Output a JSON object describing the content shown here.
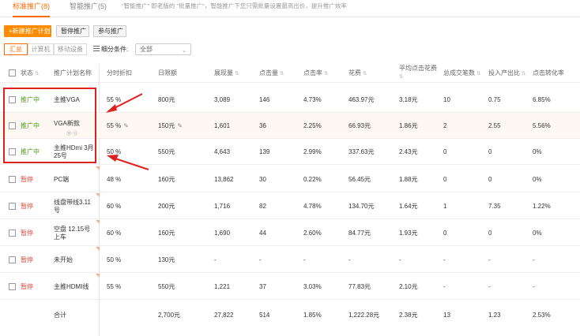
{
  "tabs": {
    "standard": "标准推广(8)",
    "smart": "智能推广(5)",
    "note": "\"智能推广\" 即老版的 \"批量推广\"，智能推广下您只需批量设置最高出价，提升推广效率"
  },
  "toolbar": {
    "new_plan": "+新建推广计划",
    "pause": "暂停推广",
    "join": "参与推广"
  },
  "device_tabs": [
    "汇总",
    "计算机",
    "移动设备"
  ],
  "filter": {
    "label": "细分条件:",
    "value": "全部"
  },
  "columns": {
    "status": "状态",
    "name": "推广计划名称",
    "discount": "分时折扣",
    "budget": "日限额",
    "impressions": "展现量",
    "clicks": "点击量",
    "ctr": "点击率",
    "cost": "花费",
    "cpc_line1": "平均点击花费",
    "deals": "总成交笔数",
    "roi": "投入产出比",
    "cvr": "点击转化率"
  },
  "rows": [
    {
      "status": "推广中",
      "on": true,
      "name": "主推VGA",
      "discount": "55 %",
      "budget": "800元",
      "impressions": "3,089",
      "clicks": "146",
      "ctr": "4.73%",
      "cost": "463.97元",
      "cpc": "3.18元",
      "deals": "10",
      "roi": "0.75",
      "cvr": "6.85%"
    },
    {
      "status": "推广中",
      "on": true,
      "name": "VGA新款",
      "discount": "55 %",
      "budget": "150元",
      "impressions": "1,601",
      "clicks": "36",
      "ctr": "2.25%",
      "cost": "66.93元",
      "cpc": "1.86元",
      "deals": "2",
      "roi": "2.55",
      "cvr": "5.56%"
    },
    {
      "status": "推广中",
      "on": true,
      "name": "主推HDmi 3月25号",
      "discount": "50 %",
      "budget": "550元",
      "impressions": "4,643",
      "clicks": "139",
      "ctr": "2.99%",
      "cost": "337.63元",
      "cpc": "2.43元",
      "deals": "0",
      "roi": "0",
      "cvr": "0%"
    },
    {
      "status": "暂停",
      "on": false,
      "name": "PC端",
      "discount": "48 %",
      "budget": "160元",
      "impressions": "13,862",
      "clicks": "30",
      "ctr": "0.22%",
      "cost": "56.45元",
      "cpc": "1.88元",
      "deals": "0",
      "roi": "0",
      "cvr": "0%"
    },
    {
      "status": "暂停",
      "on": false,
      "name": "线盘带线3.11号",
      "discount": "60 %",
      "budget": "200元",
      "impressions": "1,716",
      "clicks": "82",
      "ctr": "4.78%",
      "cost": "134.70元",
      "cpc": "1.64元",
      "deals": "1",
      "roi": "7.35",
      "cvr": "1.22%"
    },
    {
      "status": "暂停",
      "on": false,
      "name": "空盘 12.15号上车",
      "discount": "60 %",
      "budget": "160元",
      "impressions": "1,690",
      "clicks": "44",
      "ctr": "2.60%",
      "cost": "84.77元",
      "cpc": "1.93元",
      "deals": "0",
      "roi": "0",
      "cvr": "0%"
    },
    {
      "status": "暂停",
      "on": false,
      "name": "未开始",
      "discount": "50 %",
      "budget": "130元",
      "impressions": "-",
      "clicks": "-",
      "ctr": "-",
      "cost": "-",
      "cpc": "-",
      "deals": "-",
      "roi": "-",
      "cvr": "-"
    },
    {
      "status": "暂停",
      "on": false,
      "name": "主推HDMI线",
      "discount": "55 %",
      "budget": "550元",
      "impressions": "1,221",
      "clicks": "37",
      "ctr": "3.03%",
      "cost": "77.83元",
      "cpc": "2.10元",
      "deals": "-",
      "roi": "-",
      "cvr": "-"
    }
  ],
  "total": {
    "label": "合计",
    "budget": "2,700元",
    "impressions": "27,822",
    "clicks": "514",
    "ctr": "1.85%",
    "cost": "1,222.28元",
    "cpc": "2.38元",
    "deals": "13",
    "roi": "1.23",
    "cvr": "2.53%"
  },
  "colors": {
    "accent": "#ff6a00",
    "running": "#4a9c1a",
    "paused": "#e04d3f",
    "annotation": "#e02020"
  }
}
